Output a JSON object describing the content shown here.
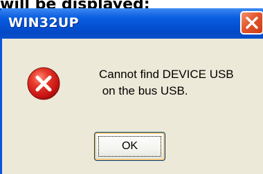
{
  "caption": {
    "visible_text": "will be displayed:"
  },
  "dialog": {
    "title": "WIN32UP",
    "message": "Cannot find DEVICE USB\n on the bus USB.",
    "icon": "error-icon",
    "buttons": {
      "ok_label": "OK"
    },
    "titlebar_controls": {
      "close_icon": "close-icon"
    }
  },
  "colors": {
    "titlebar_blue": "#0552d5",
    "close_button_red": "#e2572d",
    "dialog_background": "#ece9d8",
    "error_icon_red": "#d61818"
  }
}
